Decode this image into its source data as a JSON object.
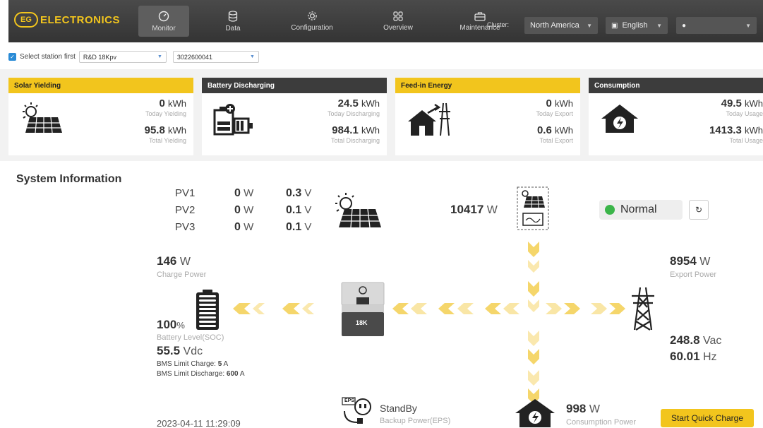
{
  "brand": {
    "badge": "EG",
    "name": "ELECTRONICS"
  },
  "nav": [
    {
      "label": "Monitor",
      "icon": "gauge-icon"
    },
    {
      "label": "Data",
      "icon": "database-icon"
    },
    {
      "label": "Configuration",
      "icon": "gear-icon"
    },
    {
      "label": "Overview",
      "icon": "grid-icon"
    },
    {
      "label": "Maintenance",
      "icon": "toolbox-icon"
    }
  ],
  "header": {
    "cluster_label": "Cluster:",
    "cluster_value": "North America",
    "language": "English",
    "user": ""
  },
  "station": {
    "select_label": "Select station first",
    "station_value": "R&D 18Kpv",
    "serial_value": "3022600041"
  },
  "cards": [
    {
      "title": "Solar Yielding",
      "today_value": "0",
      "today_unit": "kWh",
      "today_label": "Today Yielding",
      "total_value": "95.8",
      "total_unit": "kWh",
      "total_label": "Total Yielding"
    },
    {
      "title": "Battery Discharging",
      "today_value": "24.5",
      "today_unit": "kWh",
      "today_label": "Today Discharging",
      "total_value": "984.1",
      "total_unit": "kWh",
      "total_label": "Total Discharging"
    },
    {
      "title": "Feed-in Energy",
      "today_value": "0",
      "today_unit": "kWh",
      "today_label": "Today Export",
      "total_value": "0.6",
      "total_unit": "kWh",
      "total_label": "Total Export"
    },
    {
      "title": "Consumption",
      "today_value": "49.5",
      "today_unit": "kWh",
      "today_label": "Today Usage",
      "total_value": "1413.3",
      "total_unit": "kWh",
      "total_label": "Total Usage"
    }
  ],
  "system": {
    "title": "System Information",
    "pv": [
      {
        "name": "PV1",
        "power": "0",
        "power_unit": "W",
        "voltage": "0.3",
        "voltage_unit": "V"
      },
      {
        "name": "PV2",
        "power": "0",
        "power_unit": "W",
        "voltage": "0.1",
        "voltage_unit": "V"
      },
      {
        "name": "PV3",
        "power": "0",
        "power_unit": "W",
        "voltage": "0.1",
        "voltage_unit": "V"
      }
    ],
    "ac_coupled_power": "10417",
    "ac_coupled_unit": "W",
    "status": "Normal",
    "charge_power": "146",
    "charge_power_unit": "W",
    "charge_power_label": "Charge Power",
    "soc": "100",
    "soc_unit": "%",
    "soc_label": "Battery Level(SOC)",
    "battery_voltage": "55.5",
    "battery_voltage_unit": "Vdc",
    "bms_charge_label": "BMS Limit Charge:",
    "bms_charge_value": "5",
    "bms_charge_unit": "A",
    "bms_discharge_label": "BMS Limit Discharge:",
    "bms_discharge_value": "600",
    "bms_discharge_unit": "A",
    "inverter_model": "18K",
    "export_power": "8954",
    "export_power_unit": "W",
    "export_power_label": "Export Power",
    "grid_voltage": "248.8",
    "grid_voltage_unit": "Vac",
    "grid_freq": "60.01",
    "grid_freq_unit": "Hz",
    "eps_status": "StandBy",
    "eps_label": "Backup Power(EPS)",
    "eps_badge": "EPS",
    "consumption_power": "998",
    "consumption_power_unit": "W",
    "consumption_label": "Consumption Power",
    "timestamp": "2023-04-11 11:29:09",
    "quick_charge_label": "Start Quick Charge"
  },
  "colors": {
    "accent": "#f2c51d",
    "header_bg": "#3c3c3c",
    "status_ok": "#3bb54a",
    "flow": "#f5d66b"
  }
}
